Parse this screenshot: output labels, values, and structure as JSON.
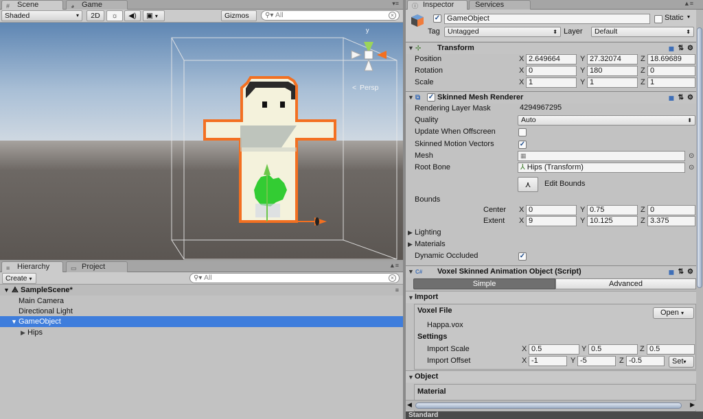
{
  "scene": {
    "tabs": [
      {
        "label": "Scene",
        "icon": "hash-icon"
      },
      {
        "label": "Game",
        "icon": "pacman-icon"
      }
    ],
    "toolbar": {
      "shading": "Shaded",
      "mode2d": "2D",
      "gizmos": "Gizmos",
      "search_placeholder": "All"
    },
    "persp_label": "Persp",
    "axis_labels": {
      "y": "y"
    }
  },
  "hierarchy": {
    "tabs": [
      {
        "label": "Hierarchy"
      },
      {
        "label": "Project"
      }
    ],
    "create_label": "Create",
    "search_placeholder": "All",
    "scene_name": "SampleScene*",
    "items": [
      "Main Camera",
      "Directional Light",
      "GameObject",
      "Hips"
    ],
    "selected": "GameObject"
  },
  "inspector": {
    "tabs": [
      {
        "label": "Inspector"
      },
      {
        "label": "Services"
      }
    ],
    "object_name": "GameObject",
    "static_label": "Static",
    "tag_label": "Tag",
    "tag_value": "Untagged",
    "layer_label": "Layer",
    "layer_value": "Default",
    "transform": {
      "title": "Transform",
      "rows": [
        {
          "label": "Position",
          "x": "2.649664",
          "y": "27.32074",
          "z": "18.69689"
        },
        {
          "label": "Rotation",
          "x": "0",
          "y": "180",
          "z": "0"
        },
        {
          "label": "Scale",
          "x": "1",
          "y": "1",
          "z": "1"
        }
      ]
    },
    "smr": {
      "title": "Skinned Mesh Renderer",
      "rendering_layer_mask_label": "Rendering Layer Mask",
      "rendering_layer_mask_value": "4294967295",
      "quality_label": "Quality",
      "quality_value": "Auto",
      "update_offscreen_label": "Update When Offscreen",
      "skinned_motion_label": "Skinned Motion Vectors",
      "mesh_label": "Mesh",
      "root_bone_label": "Root Bone",
      "root_bone_value": "Hips (Transform)",
      "edit_bounds_label": "Edit Bounds",
      "bounds_label": "Bounds",
      "center_label": "Center",
      "center": {
        "x": "0",
        "y": "0.75",
        "z": "0"
      },
      "extent_label": "Extent",
      "extent": {
        "x": "9",
        "y": "10.125",
        "z": "3.375"
      },
      "lighting_label": "Lighting",
      "materials_label": "Materials",
      "dynamic_occluded_label": "Dynamic Occluded"
    },
    "voxel": {
      "title": "Voxel Skinned Animation Object (Script)",
      "tab_simple": "Simple",
      "tab_advanced": "Advanced",
      "import_label": "Import",
      "voxel_file_label": "Voxel File",
      "open_label": "Open",
      "file_name": "Happa.vox",
      "settings_label": "Settings",
      "import_scale_label": "Import Scale",
      "import_scale": {
        "x": "0.5",
        "y": "0.5",
        "z": "0.5"
      },
      "import_offset_label": "Import Offset",
      "import_offset": {
        "x": "-1",
        "y": "-5",
        "z": "-0.5"
      },
      "set_label": "Set",
      "object_label": "Object",
      "material_label": "Material"
    },
    "footer_label": "Standard"
  }
}
